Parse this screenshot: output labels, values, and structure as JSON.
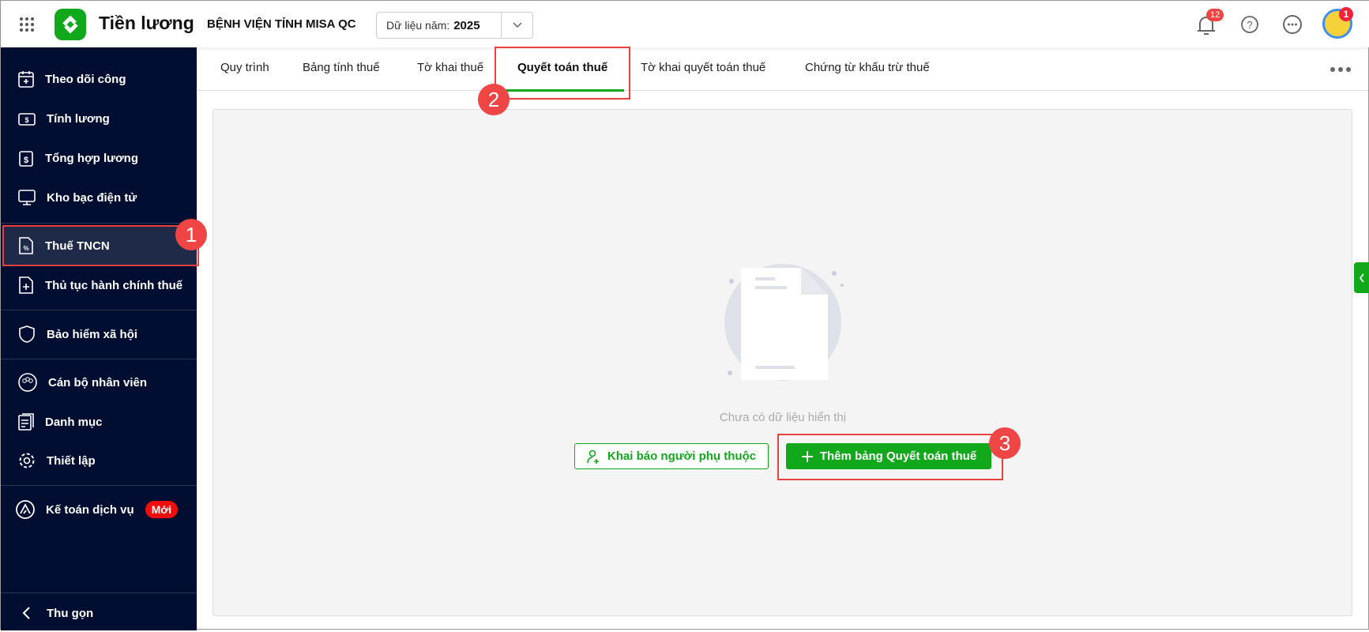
{
  "header": {
    "app_title": "Tiền lương",
    "org_name": "BỆNH VIỆN TỈNH MISA QC",
    "year_label": "Dữ liệu năm:",
    "year_value": "2025",
    "notification_count": "12",
    "avatar_badge": "1"
  },
  "sidebar": {
    "items": [
      {
        "label": "Theo dõi công"
      },
      {
        "label": "Tính lương"
      },
      {
        "label": "Tổng hợp lương"
      },
      {
        "label": "Kho bạc điện tử"
      },
      {
        "label": "Thuế TNCN"
      },
      {
        "label": "Thủ tục hành chính thuế"
      },
      {
        "label": "Bảo hiểm xã hội"
      },
      {
        "label": "Cán bộ nhân viên"
      },
      {
        "label": "Danh mục"
      },
      {
        "label": "Thiết lập"
      },
      {
        "label": "Kế toán dịch vụ",
        "badge": "Mới"
      }
    ],
    "collapse_label": "Thu gọn"
  },
  "tabs": [
    {
      "label": "Quy trình"
    },
    {
      "label": "Bảng tính thuế"
    },
    {
      "label": "Tờ khai thuế"
    },
    {
      "label": "Quyết toán thuế"
    },
    {
      "label": "Tờ khai quyết toán thuế"
    },
    {
      "label": "Chứng từ khấu trừ thuế"
    }
  ],
  "main": {
    "empty_text": "Chưa có dữ liệu hiển thị",
    "declare_dependent_label": "Khai báo người phụ thuộc",
    "add_settlement_label": "Thêm bảng Quyết toán thuế"
  },
  "annotations": {
    "step1": "1",
    "step2": "2",
    "step3": "3"
  },
  "colors": {
    "brand": "#12a81c",
    "sidebar": "#010e31",
    "annotation": "#f04545"
  }
}
